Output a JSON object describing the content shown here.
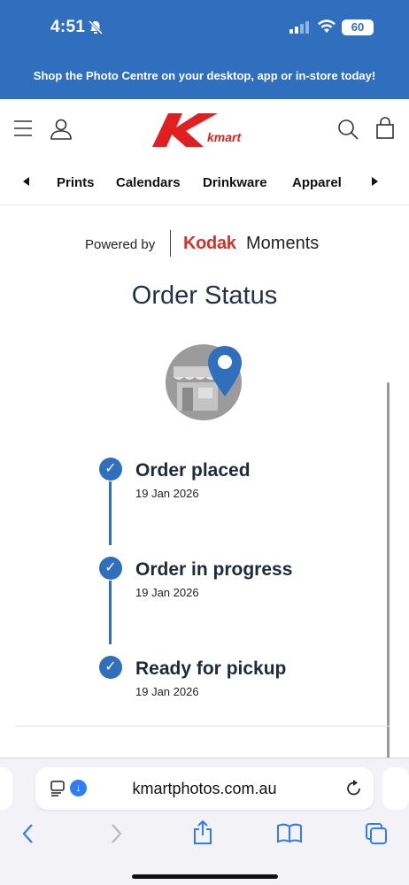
{
  "status_bar": {
    "time": "4:51",
    "battery": "60"
  },
  "promo": {
    "text": "Shop the Photo Centre on your desktop, app or in-store today!"
  },
  "header": {
    "logo_text": "kmart"
  },
  "categories": {
    "items": [
      "Prints",
      "Calendars",
      "Drinkware",
      "Apparel"
    ]
  },
  "powered_by": {
    "label": "Powered by",
    "brand": "Kodak",
    "brand_suffix": "Moments"
  },
  "page": {
    "title": "Order Status"
  },
  "steps": [
    {
      "label": "Order placed",
      "date": "19 Jan 2026",
      "done": true
    },
    {
      "label": "Order in progress",
      "date": "19 Jan 2026",
      "done": true
    },
    {
      "label": "Ready for pickup",
      "date": "19 Jan 2026",
      "done": true
    }
  ],
  "browser": {
    "url": "kmartphotos.com.au"
  },
  "colors": {
    "brand_blue": "#2f6fbe",
    "kmart_red": "#e02020",
    "kodak_red": "#d1322b"
  },
  "icons": [
    "bell-off-icon",
    "signal-icon",
    "wifi-icon",
    "menu-icon",
    "account-icon",
    "search-icon",
    "bag-icon",
    "store-location-icon",
    "check-icon",
    "reader-icon",
    "download-icon",
    "reload-icon",
    "back-icon",
    "forward-icon",
    "share-icon",
    "bookmarks-icon",
    "tabs-icon"
  ]
}
